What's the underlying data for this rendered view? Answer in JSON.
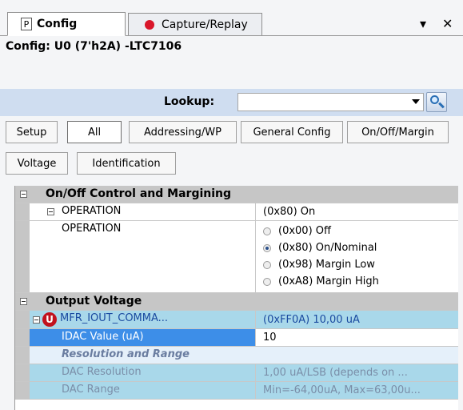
{
  "tabs": {
    "config_label": "Config",
    "pin_label": "P",
    "capture_label": "Capture/Replay",
    "dropdown_glyph": "▾",
    "close_glyph": "✕"
  },
  "config_title": "Config: U0 (7'h2A) -LTC7106",
  "lookup": {
    "label": "Lookup:",
    "value": ""
  },
  "filter_buttons": {
    "setup": "Setup",
    "all": "All",
    "addressing": "Addressing/WP",
    "general": "General Config",
    "onoff": "On/Off/Margin",
    "voltage": "Voltage",
    "identification": "Identification"
  },
  "grid": {
    "cat1": "On/Off Control and Margining",
    "operation_name": "OPERATION",
    "operation_value": "(0x80) On",
    "operation_detail_name": "OPERATION",
    "options": [
      "(0x00) Off",
      "(0x80) On/Nominal",
      "(0x98) Margin Low",
      "(0xA8) Margin High"
    ],
    "selected_option": 1,
    "cat2": "Output Voltage",
    "mfr_icon": "U",
    "mfr_name": "MFR_IOUT_COMMA...",
    "mfr_value": "(0xFF0A) 10,00 uA",
    "idac_name": "IDAC Value (uA)",
    "idac_value": "10",
    "subsection": "Resolution and Range",
    "dac_res_name": "DAC Resolution",
    "dac_res_value": "1,00 uA/LSB (depends on ...",
    "dac_range_name": "DAC Range",
    "dac_range_value": "Min=-64,00uA, Max=63,00u..."
  },
  "colors": {
    "lookup_band": "#cfddf0",
    "category_bg": "#c6c6c6",
    "selected_row": "#3d8ee8",
    "highlight_row": "#a9d8ea",
    "record_dot": "#d9162a"
  }
}
